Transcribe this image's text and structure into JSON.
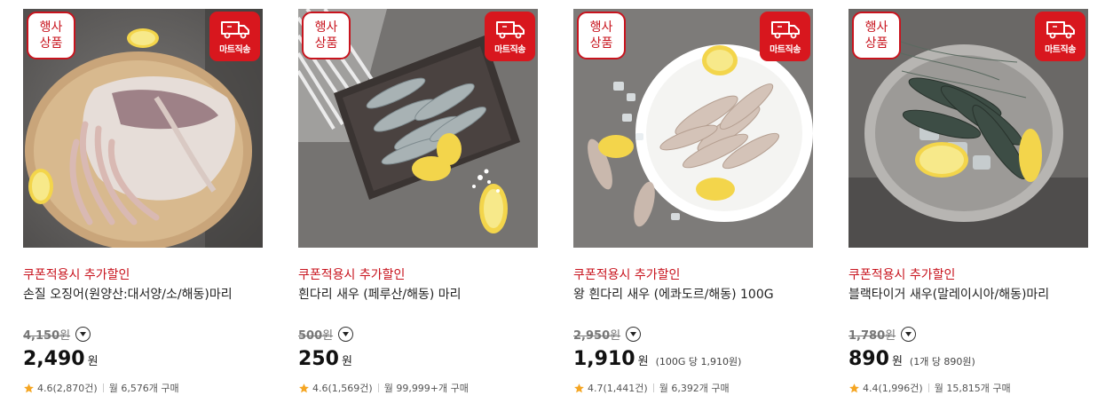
{
  "products": [
    {
      "event_badge": [
        "행사",
        "상품"
      ],
      "delivery_label": "마트직송",
      "promo": "쿠폰적용시 추가할인",
      "name": "손질 오징어(원양산:대서양/소/해동)마리",
      "original_price": "4,150",
      "original_unit": "원",
      "price": "2,490",
      "price_unit": "원",
      "unit_price": "",
      "rating": "4.6",
      "reviews": "(2,870건)",
      "monthly": "월 6,576개 구매",
      "image": "squid-photo"
    },
    {
      "event_badge": [
        "행사",
        "상품"
      ],
      "delivery_label": "마트직송",
      "promo": "쿠폰적용시 추가할인",
      "name": "흰다리 새우 (페루산/해동) 마리",
      "original_price": "500",
      "original_unit": "원",
      "price": "250",
      "price_unit": "원",
      "unit_price": "",
      "rating": "4.6",
      "reviews": "(1,569건)",
      "monthly": "월 99,999+개 구매",
      "image": "shrimp-tray-photo"
    },
    {
      "event_badge": [
        "행사",
        "상품"
      ],
      "delivery_label": "마트직송",
      "promo": "쿠폰적용시 추가할인",
      "name": "왕 흰다리 새우 (에콰도르/해동) 100G",
      "original_price": "2,950",
      "original_unit": "원",
      "price": "1,910",
      "price_unit": "원",
      "unit_price": "(100G 당 1,910원)",
      "rating": "4.7",
      "reviews": "(1,441건)",
      "monthly": "월 6,392개 구매",
      "image": "shrimp-plate-photo"
    },
    {
      "event_badge": [
        "행사",
        "상품"
      ],
      "delivery_label": "마트직송",
      "promo": "쿠폰적용시 추가할인",
      "name": "블랙타이거 새우(말레이시아/해동)마리",
      "original_price": "1,780",
      "original_unit": "원",
      "price": "890",
      "price_unit": "원",
      "unit_price": "(1개 당 890원)",
      "rating": "4.4",
      "reviews": "(1,996건)",
      "monthly": "월 15,815개 구매",
      "image": "black-tiger-shrimp-photo"
    }
  ],
  "colors": {
    "accent_red": "#c8141e",
    "star": "#f5a623",
    "photo_bg": "#6d6b69"
  },
  "icons": {
    "delivery": "truck-icon",
    "info": "chevron-down-icon",
    "rating": "star-icon"
  }
}
